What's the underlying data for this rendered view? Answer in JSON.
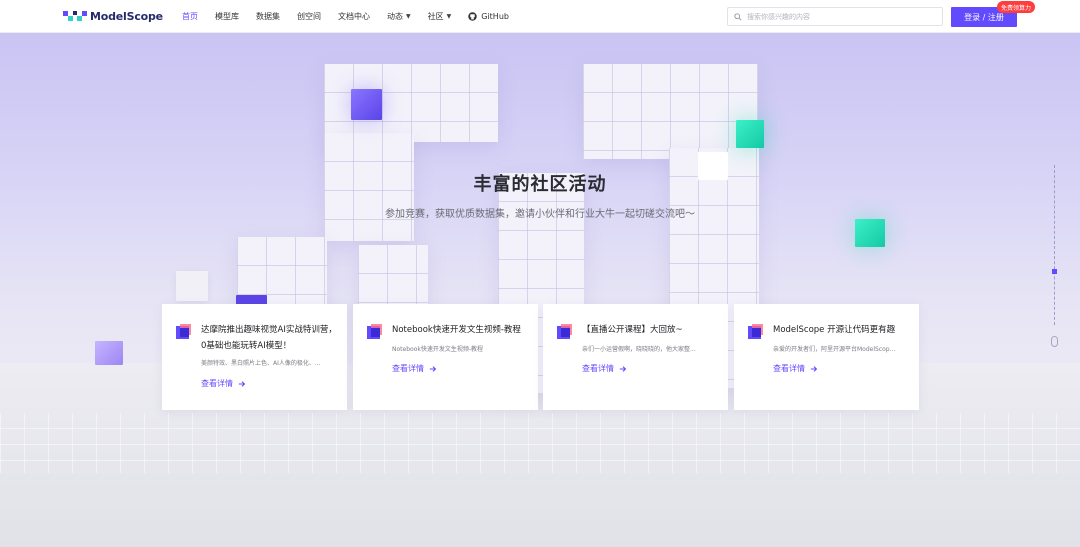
{
  "header": {
    "logo_text": "ModelScope",
    "nav": [
      {
        "label": "首页",
        "active": true
      },
      {
        "label": "模型库"
      },
      {
        "label": "数据集"
      },
      {
        "label": "创空间"
      },
      {
        "label": "文档中心"
      },
      {
        "label": "动态",
        "dropdown": true
      },
      {
        "label": "社区",
        "dropdown": true
      },
      {
        "label": "GitHub",
        "icon": "github-icon"
      }
    ],
    "search_placeholder": "搜索你感兴趣的内容",
    "login_label": "登录 / 注册",
    "promo_badge": "免费领算力"
  },
  "hero": {
    "title": "丰富的社区活动",
    "subtitle": "参加竞赛，获取优质数据集，邀请小伙伴和行业大牛一起切磋交流吧～"
  },
  "cards": [
    {
      "title": "达摩院推出趣味视觉AI实战特训营，0基础也能玩转AI模型！",
      "desc": "美颜特效、黑白照片上色、AI人像的极化、...",
      "link": "查看详情"
    },
    {
      "title": "Notebook快速开发文生视频-教程",
      "desc": "Notebook快速开发文生视频-教程",
      "link": "查看详情"
    },
    {
      "title": "【直播公开课程】大回放~",
      "desc": "亲们一小运营假啊，晓晓晓的，他大家整...",
      "link": "查看详情"
    },
    {
      "title": "ModelScope 开源让代码更有趣",
      "desc": "亲爱的开发者们，阿里开源平台ModelScop...",
      "link": "查看详情"
    }
  ],
  "colors": {
    "brand": "#624aff",
    "badge": "#ff3d3d",
    "accent_cube": "#1fd6b0"
  }
}
